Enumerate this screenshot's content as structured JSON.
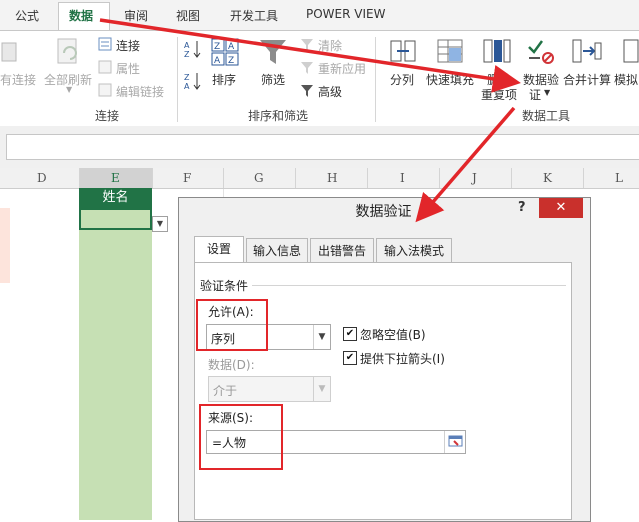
{
  "ribbon": {
    "tabs": [
      "公式",
      "数据",
      "审阅",
      "视图",
      "开发工具",
      "POWER VIEW"
    ],
    "active_tab": "数据",
    "connections": {
      "cut_label": "有连接",
      "refresh_all": "全部刷新",
      "connections": "连接",
      "properties": "属性",
      "edit_links": "编辑链接",
      "group": "连接"
    },
    "sort_filter": {
      "sort": "排序",
      "filter": "筛选",
      "clear": "清除",
      "reapply": "重新应用",
      "advanced": "高级",
      "group": "排序和筛选"
    },
    "data_tools": {
      "text_to_columns": "分列",
      "flash_fill": "快速填充",
      "remove_dup_line1": "删除",
      "remove_dup_line2": "重复项",
      "data_validation_line1": "数据验",
      "data_validation_line2": "证",
      "consolidate": "合并计算",
      "whatif": "模拟",
      "group": "数据工具"
    }
  },
  "sheet": {
    "columns": [
      "D",
      "E",
      "F",
      "G",
      "H",
      "I",
      "J",
      "K",
      "L"
    ],
    "header_cell": "姓名"
  },
  "dialog": {
    "title": "数据验证",
    "help": "?",
    "close": "✕",
    "tabs": [
      "设置",
      "输入信息",
      "出错警告",
      "输入法模式"
    ],
    "criteria_label": "验证条件",
    "allow_label": "允许(A):",
    "allow_value": "序列",
    "ignore_blank": "忽略空值(B)",
    "ignore_blank_checked": true,
    "dropdown_label": "提供下拉箭头(I)",
    "dropdown_checked": true,
    "data_label": "数据(D):",
    "data_value": "介于",
    "source_label": "来源(S):",
    "source_value": "=人物"
  },
  "colors": {
    "excel_green": "#217346",
    "selection_fill": "#c6e0b4",
    "annotation_red": "#e2262a"
  }
}
